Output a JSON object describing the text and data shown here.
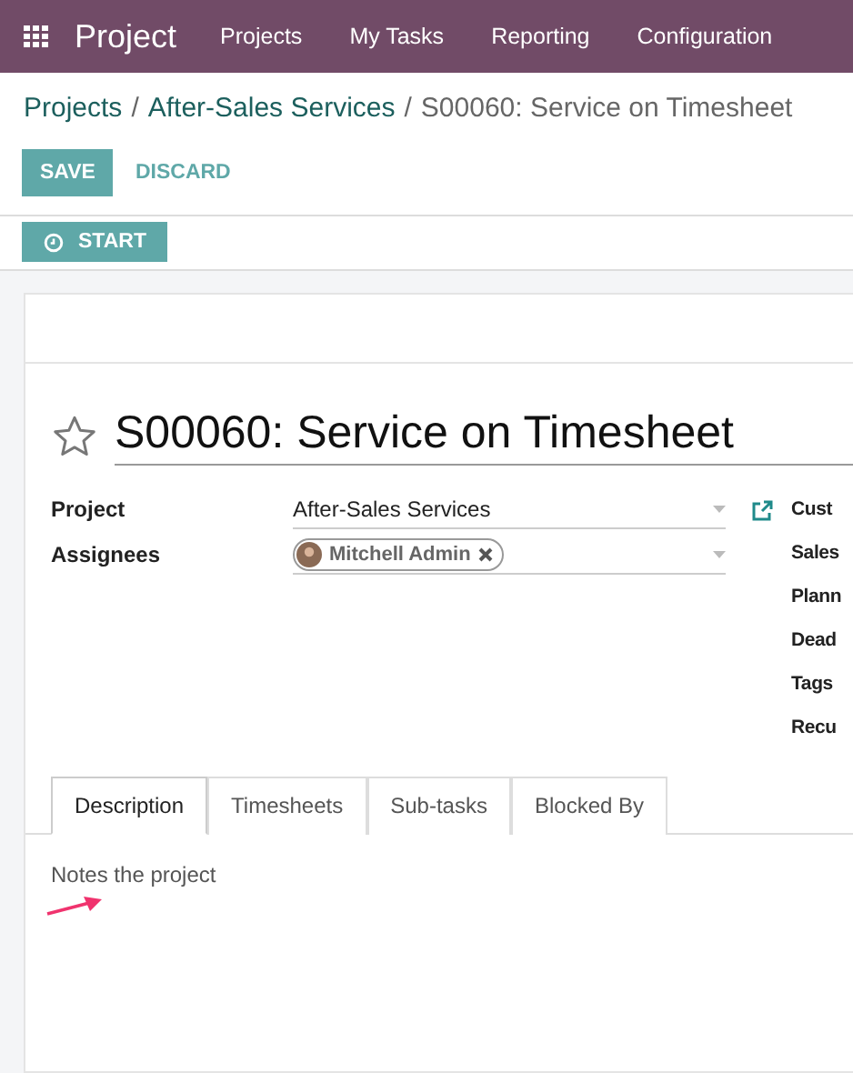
{
  "navbar": {
    "app_name": "Project",
    "menu": [
      "Projects",
      "My Tasks",
      "Reporting",
      "Configuration"
    ]
  },
  "breadcrumb": {
    "links": [
      "Projects",
      "After-Sales Services"
    ],
    "separator": "/",
    "current": "S00060: Service on Timesheet"
  },
  "buttons": {
    "save": "SAVE",
    "discard": "DISCARD",
    "start": "START"
  },
  "task": {
    "title": "S00060: Service on Timesheet",
    "starred": false
  },
  "fields": [
    {
      "label": "Project",
      "kind": "many2one",
      "value": "After-Sales Services"
    },
    {
      "label": "Assignees",
      "kind": "tags",
      "tags": [
        "Mitchell Admin"
      ]
    }
  ],
  "right_fields": [
    "Cust",
    "Sales",
    "Plann",
    "Dead",
    "Tags",
    "Recu"
  ],
  "tabs": [
    {
      "label": "Description",
      "selected": true
    },
    {
      "label": "Timesheets",
      "selected": false
    },
    {
      "label": "Sub-tasks",
      "selected": false
    },
    {
      "label": "Blocked By",
      "selected": false
    }
  ],
  "description": "Notes the project"
}
